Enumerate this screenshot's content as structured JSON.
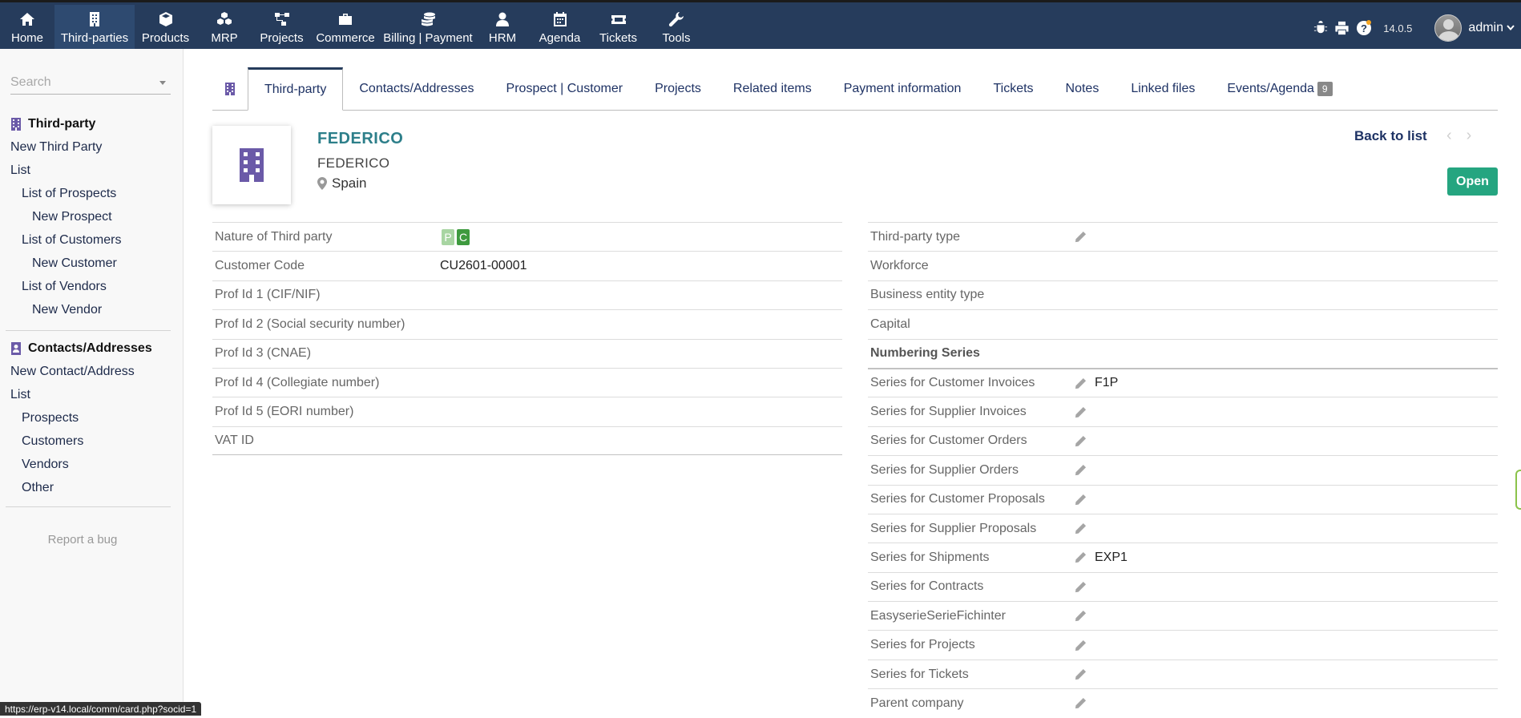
{
  "topnav": [
    {
      "label": "Home",
      "icon": "home-icon"
    },
    {
      "label": "Third-parties",
      "icon": "building-icon"
    },
    {
      "label": "Products",
      "icon": "cube-icon"
    },
    {
      "label": "MRP",
      "icon": "cubes-icon"
    },
    {
      "label": "Projects",
      "icon": "sitemap-icon"
    },
    {
      "label": "Commerce",
      "icon": "suitcase-icon"
    },
    {
      "label": "Billing | Payment",
      "icon": "coins-icon"
    },
    {
      "label": "HRM",
      "icon": "user-icon"
    },
    {
      "label": "Agenda",
      "icon": "calendar-icon"
    },
    {
      "label": "Tickets",
      "icon": "ticket-icon"
    },
    {
      "label": "Tools",
      "icon": "wrench-icon"
    }
  ],
  "topright": {
    "version": "14.0.5",
    "username": "admin"
  },
  "sidebar": {
    "search_placeholder": "Search",
    "third_party": {
      "title": "Third-party",
      "items": [
        "New Third Party",
        "List",
        "List of Prospects",
        "New Prospect",
        "List of Customers",
        "New Customer",
        "List of Vendors",
        "New Vendor"
      ]
    },
    "contacts": {
      "title": "Contacts/Addresses",
      "items": [
        "New Contact/Address",
        "List",
        "Prospects",
        "Customers",
        "Vendors",
        "Other"
      ]
    },
    "report_bug": "Report a bug"
  },
  "tabs": [
    "Third-party",
    "Contacts/Addresses",
    "Prospect | Customer",
    "Projects",
    "Related items",
    "Payment information",
    "Tickets",
    "Notes",
    "Linked files",
    "Events/Agenda"
  ],
  "events_count": "9",
  "header": {
    "name": "FEDERICO",
    "alias": "FEDERICO",
    "country": "Spain",
    "back_to_list": "Back to list",
    "status": "Open"
  },
  "left_fields": {
    "nature_label": "Nature of Third party",
    "nature_tags": [
      "P",
      "C"
    ],
    "customer_code_label": "Customer Code",
    "customer_code": "CU2601-00001",
    "prof1": "Prof Id 1 (CIF/NIF)",
    "prof2": "Prof Id 2 (Social security number)",
    "prof3": "Prof Id 3 (CNAE)",
    "prof4": "Prof Id 4 (Collegiate number)",
    "prof5": "Prof Id 5 (EORI number)",
    "vat": "VAT ID"
  },
  "right_fields": {
    "type": "Third-party type",
    "workforce": "Workforce",
    "business_type": "Business entity type",
    "capital": "Capital",
    "numbering": "Numbering Series",
    "series": [
      {
        "label": "Series for Customer Invoices",
        "value": "F1P"
      },
      {
        "label": "Series for Supplier Invoices",
        "value": ""
      },
      {
        "label": "Series for Customer Orders",
        "value": ""
      },
      {
        "label": "Series for Supplier Orders",
        "value": ""
      },
      {
        "label": "Series for Customer Proposals",
        "value": ""
      },
      {
        "label": "Series for Supplier Proposals",
        "value": ""
      },
      {
        "label": "Series for Shipments",
        "value": "EXP1"
      },
      {
        "label": "Series for Contracts",
        "value": ""
      },
      {
        "label": "EasyserieSerieFichinter",
        "value": ""
      },
      {
        "label": "Series for Projects",
        "value": ""
      },
      {
        "label": "Series for Tickets",
        "value": ""
      },
      {
        "label": "Parent company",
        "value": ""
      }
    ]
  },
  "statusbar": "https://erp-v14.local/comm/card.php?socid=1",
  "colors": {
    "topbar": "#263c5c",
    "accent": "#6b5aa8",
    "name": "#2d7f8a",
    "open": "#25a580",
    "tag_p": "#a8d5a2",
    "tag_c": "#3e9a3f"
  }
}
